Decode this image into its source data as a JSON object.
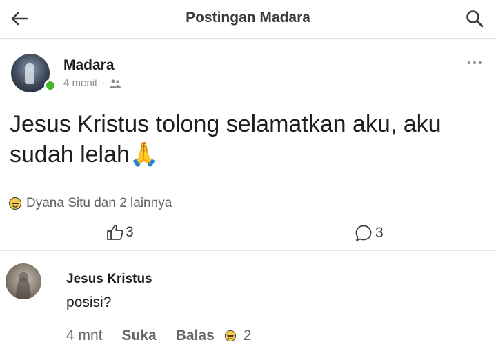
{
  "header": {
    "title": "Postingan Madara",
    "back_icon": "arrow-left-icon",
    "search_icon": "search-icon"
  },
  "post": {
    "author": "Madara",
    "time": "4 menit",
    "separator": "·",
    "audience_icon": "friends-icon",
    "text": "Jesus Kristus tolong selamatkan aku, aku sudah lelah",
    "emoji": "🙏",
    "reactions_summary": "Dyana Situ dan 2 lainnya",
    "reaction_icon": "emoji-face-icon",
    "like_count": "3",
    "comment_count": "3"
  },
  "comment": {
    "author": "Jesus Kristus",
    "text": "posisi?",
    "time": "4 mnt",
    "like_label": "Suka",
    "reply_label": "Balas",
    "reaction_count": "2"
  },
  "colors": {
    "online": "#42b72a",
    "text": "#1c1e21",
    "muted": "#65676b"
  }
}
